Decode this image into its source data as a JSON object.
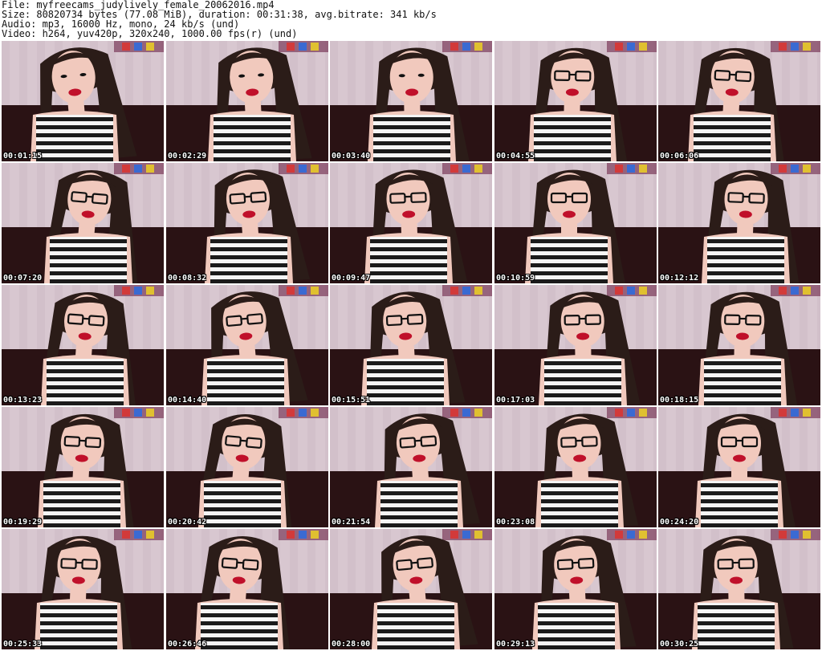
{
  "header": {
    "file_line": "File: myfreecams_judylively_female_20062016.mp4",
    "size_line": "Size: 80820734 bytes (77.08 MiB), duration: 00:31:38, avg.bitrate: 341 kb/s",
    "audio_line": "Audio: mp3, 16000 Hz, mono, 24 kb/s (und)",
    "video_line": "Video: h264, yuv420p, 320x240, 1000.00 fps(r) (und)"
  },
  "thumbnails": [
    {
      "timestamp": "00:01:15",
      "glasses": false
    },
    {
      "timestamp": "00:02:29",
      "glasses": false
    },
    {
      "timestamp": "00:03:40",
      "glasses": false
    },
    {
      "timestamp": "00:04:55",
      "glasses": true
    },
    {
      "timestamp": "00:06:06",
      "glasses": true
    },
    {
      "timestamp": "00:07:20",
      "glasses": true
    },
    {
      "timestamp": "00:08:32",
      "glasses": true
    },
    {
      "timestamp": "00:09:47",
      "glasses": true
    },
    {
      "timestamp": "00:10:59",
      "glasses": true
    },
    {
      "timestamp": "00:12:12",
      "glasses": true
    },
    {
      "timestamp": "00:13:23",
      "glasses": true
    },
    {
      "timestamp": "00:14:40",
      "glasses": true
    },
    {
      "timestamp": "00:15:51",
      "glasses": true
    },
    {
      "timestamp": "00:17:03",
      "glasses": true
    },
    {
      "timestamp": "00:18:15",
      "glasses": true
    },
    {
      "timestamp": "00:19:29",
      "glasses": true
    },
    {
      "timestamp": "00:20:42",
      "glasses": true
    },
    {
      "timestamp": "00:21:54",
      "glasses": true
    },
    {
      "timestamp": "00:23:08",
      "glasses": true
    },
    {
      "timestamp": "00:24:20",
      "glasses": true
    },
    {
      "timestamp": "00:25:33",
      "glasses": true
    },
    {
      "timestamp": "00:26:46",
      "glasses": true
    },
    {
      "timestamp": "00:28:00",
      "glasses": true
    },
    {
      "timestamp": "00:29:13",
      "glasses": true
    },
    {
      "timestamp": "00:30:25",
      "glasses": true
    }
  ],
  "colors": {
    "wall": "#d8c7d0",
    "wall_stripe": "#c9b4c0",
    "background_dark": "#2a1214",
    "hair": "#2b1c18",
    "skin": "#f1c9bd",
    "lips": "#c0102a",
    "stripe_dark": "#1b1b1b",
    "stripe_light": "#f5f5f5",
    "glasses": "#111111",
    "timestamp_text": "#ffffff"
  }
}
